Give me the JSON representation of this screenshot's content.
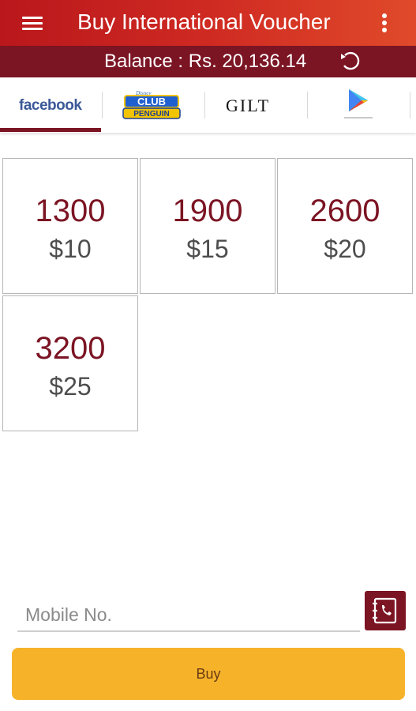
{
  "header": {
    "title": "Buy International Voucher",
    "menu_icon": "hamburger-menu-icon",
    "overflow_icon": "overflow-menu-icon"
  },
  "balance": {
    "text": "Balance : Rs. 20,136.14",
    "refresh_icon": "refresh-icon"
  },
  "tabs": [
    {
      "label": "facebook",
      "selected": true
    },
    {
      "label": "Club Penguin",
      "selected": false
    },
    {
      "label": "GILT",
      "selected": false
    },
    {
      "label": "Google Play",
      "selected": false
    }
  ],
  "vouchers": [
    {
      "points": "1300",
      "price": "$10"
    },
    {
      "points": "1900",
      "price": "$15"
    },
    {
      "points": "2600",
      "price": "$20"
    },
    {
      "points": "3200",
      "price": "$25"
    }
  ],
  "form": {
    "mobile_placeholder": "Mobile No.",
    "mobile_value": "",
    "contacts_icon": "contacts-book-icon",
    "buy_label": "Buy"
  },
  "colors": {
    "appbar": "#c8241f",
    "balance_bar": "#7b1423",
    "accent": "#7b1423",
    "buy_button": "#f6b32a"
  }
}
